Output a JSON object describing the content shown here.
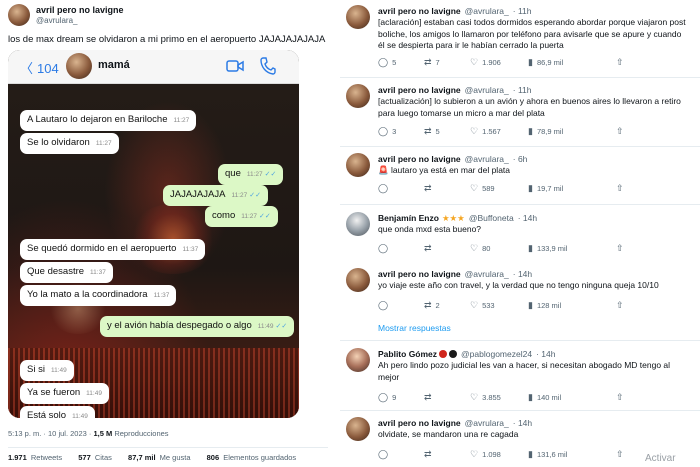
{
  "main_tweet": {
    "author_name": "avril pero no lavigne",
    "author_handle": "@avrulara_",
    "text": "los de max dream se olvidaron a mi primo en el aeropuerto JAJAJAJAJAJA",
    "meta_time": "5:13 p. m. · 10 jul. 2023 ·",
    "meta_views": "1,5 M",
    "meta_views_label": "Reproducciones",
    "stats": [
      {
        "value": "1.971",
        "label": "Retweets"
      },
      {
        "value": "577",
        "label": "Citas"
      },
      {
        "value": "87,7 mil",
        "label": "Me gusta"
      },
      {
        "value": "806",
        "label": "Elementos guardados"
      }
    ]
  },
  "phone": {
    "back_count": "104",
    "contact_name": "mamá",
    "messages": [
      {
        "dir": "in",
        "text": "A Lautaro lo dejaron en Bariloche",
        "time": "11:27"
      },
      {
        "dir": "in",
        "text": "Se lo olvidaron",
        "time": "11:27"
      },
      {
        "dir": "out",
        "text": "que",
        "time": "11:27"
      },
      {
        "dir": "out",
        "text": "JAJAJAJAJA",
        "time": "11:27"
      },
      {
        "dir": "out",
        "text": "como",
        "time": "11:27"
      },
      {
        "dir": "in",
        "text": "Se quedó dormido en el aeropuerto",
        "time": "11:37"
      },
      {
        "dir": "in",
        "text": "Que desastre",
        "time": "11:37"
      },
      {
        "dir": "in",
        "text": "Yo la mato a la coordinadora",
        "time": "11:37"
      },
      {
        "dir": "out",
        "text": "y el avión había despegado o algo",
        "time": "11:49"
      },
      {
        "dir": "in",
        "text": "Si si",
        "time": "11:49"
      },
      {
        "dir": "in",
        "text": "Ya se fueron",
        "time": "11:49"
      },
      {
        "dir": "in",
        "text": "Está solo",
        "time": "11:49"
      }
    ]
  },
  "replies": [
    {
      "name": "avril pero no lavigne",
      "handle": "@avrulara_",
      "time": "· 11h",
      "text": "[aclaración] estaban casi todos dormidos  esperando abordar porque viajaron post boliche, los amigos lo llamaron por teléfono para avisarle que se apure y cuando él se despierta para ir le habían cerrado la puerta",
      "replies": "5",
      "retweets": "7",
      "likes": "1.906",
      "views": "86,9 mil"
    },
    {
      "name": "avril pero no lavigne",
      "handle": "@avrulara_",
      "time": "· 11h",
      "text": "[actualización] lo subieron a un avión y ahora en buenos aires lo llevaron a retiro para luego tomarse un micro a mar del plata",
      "replies": "3",
      "retweets": "5",
      "likes": "1.567",
      "views": "78,9 mil"
    },
    {
      "name": "avril pero no lavigne",
      "handle": "@avrulara_",
      "time": "· 6h",
      "text": "🚨 lautaro ya está en mar del plata",
      "replies": "",
      "retweets": "",
      "likes": "589",
      "views": "19,7 mil"
    },
    {
      "name": "Benjamín Enzo",
      "handle": "@Buffoneta",
      "time": "· 14h",
      "stars": "★★★",
      "text": "que onda mxd esta bueno?",
      "replies": "",
      "retweets": "",
      "likes": "80",
      "views": "133,9 mil"
    },
    {
      "name": "avril pero no lavigne",
      "handle": "@avrulara_",
      "time": "· 14h",
      "text": "yo viaje este año con travel, y la verdad que no tengo ninguna queja 10/10",
      "replies": "",
      "retweets": "2",
      "likes": "533",
      "views": "128 mil"
    },
    {
      "name": "Pablito Gómez",
      "handle": "@pablogomezel24",
      "time": "· 14h",
      "text": "Ah pero lindo pozo judicial les van a hacer, si necesitan abogado MD tengo al mejor",
      "replies": "9",
      "retweets": "",
      "likes": "3.855",
      "views": "140 mil"
    },
    {
      "name": "avril pero no lavigne",
      "handle": "@avrulara_",
      "time": "· 14h",
      "text": "olvidate, se mandaron una re cagada",
      "replies": "",
      "retweets": "",
      "likes": "1.098",
      "views": "131,6 mil"
    }
  ],
  "show_more": "Mostrar respuestas",
  "watermark": "Activar",
  "colors": {
    "accent": "#1d9bf0",
    "muted": "#536471",
    "outgoing_bubble": "#dcf8c6"
  }
}
